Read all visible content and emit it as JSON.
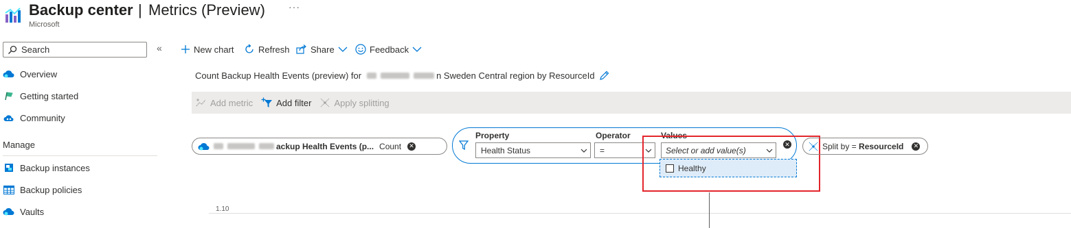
{
  "header": {
    "title": "Backup center",
    "separator": "|",
    "subtitle": "Metrics (Preview)",
    "more": "···",
    "publisher": "Microsoft"
  },
  "sidebar": {
    "search_placeholder": "Search",
    "collapse": "«",
    "items": [
      {
        "label": "Overview",
        "icon": "cloud-gear-icon"
      },
      {
        "label": "Getting started",
        "icon": "flag-icon"
      },
      {
        "label": "Community",
        "icon": "community-cloud-icon"
      }
    ],
    "manage_header": "Manage",
    "manage_items": [
      {
        "label": "Backup instances",
        "icon": "database-icon"
      },
      {
        "label": "Backup policies",
        "icon": "table-icon"
      },
      {
        "label": "Vaults",
        "icon": "cloud-icon"
      }
    ]
  },
  "commands": {
    "new_chart": "New chart",
    "refresh": "Refresh",
    "share": "Share",
    "feedback": "Feedback"
  },
  "chart": {
    "title_prefix": "Count Backup Health Events (preview) for",
    "title_suffix": "n Sweden Central region by ResourceId",
    "y_tick": "1.10"
  },
  "toolbar": {
    "add_metric": "Add metric",
    "add_filter": "Add filter",
    "apply_splitting": "Apply splitting"
  },
  "metric_pill": {
    "name": "ackup Health Events (p...",
    "aggregation": "Count"
  },
  "filter": {
    "property_label": "Property",
    "property_value": "Health Status",
    "operator_label": "Operator",
    "operator_value": "=",
    "values_label": "Values",
    "values_placeholder": "Select or add value(s)",
    "options": [
      "Healthy"
    ]
  },
  "split_pill": {
    "label": "Split by = ",
    "value": "ResourceId"
  },
  "colors": {
    "accent": "#0078d4",
    "highlight": "#e3242b",
    "toolbar_bg": "#edebe9"
  }
}
